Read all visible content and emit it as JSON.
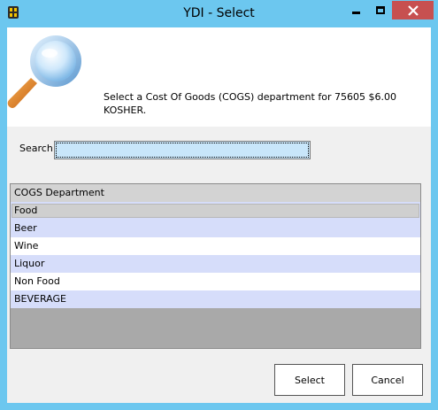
{
  "window": {
    "title": "YDI - Select",
    "icon": "ydi-app-icon"
  },
  "header": {
    "icon": "magnifier-icon",
    "prompt": "Select a Cost Of Goods (COGS) department for 75605 $6.00 KOSHER."
  },
  "search": {
    "label": "Search",
    "value": ""
  },
  "grid": {
    "column_header": "COGS Department",
    "rows": [
      "Food",
      "Beer",
      "Wine",
      "Liquor",
      "Non Food",
      "BEVERAGE"
    ],
    "selected_index": 0
  },
  "buttons": {
    "select_label": "Select",
    "cancel_label": "Cancel"
  },
  "colors": {
    "title_bar": "#6cc7ef",
    "close_button": "#c75050",
    "row_alt": "#d6ddfa",
    "grid_empty": "#a9a9a9",
    "search_bg": "#c8e6fa"
  }
}
